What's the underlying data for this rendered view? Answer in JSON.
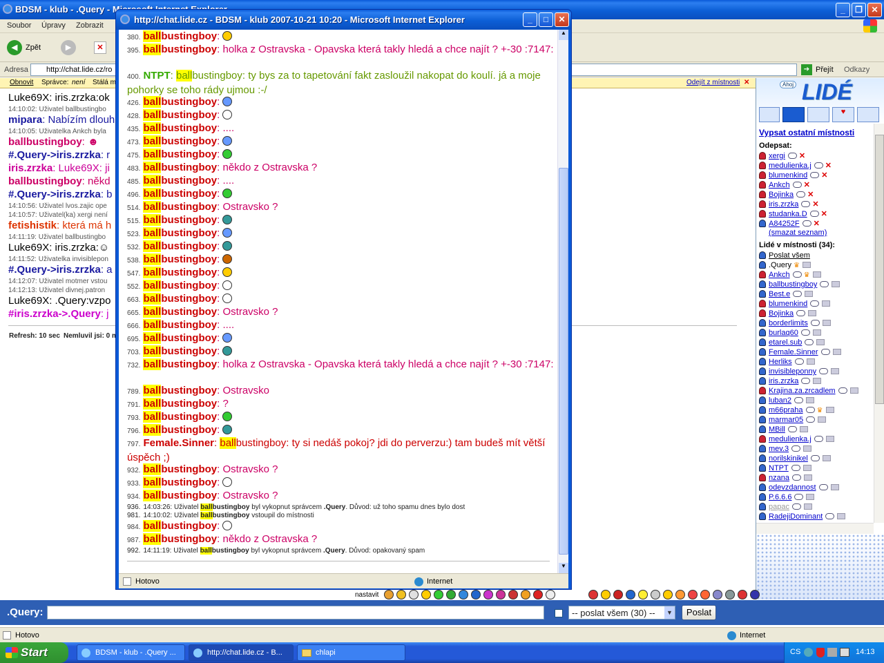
{
  "back_window": {
    "title": "BDSM - klub - .Query - Microsoft Internet Explorer",
    "menu": [
      "Soubor",
      "Úpravy",
      "Zobrazit"
    ],
    "back_label": "Zpět",
    "address_label": "Adresa",
    "address_value": "http://chat.lide.cz/ro",
    "go_label": "Přejít",
    "links_label": "Odkazy",
    "topbar": {
      "refresh": "Obnovit",
      "admin": "Správce:",
      "admin_value": "není",
      "stale": "Stálá m",
      "leave": "Odejít z místnosti"
    },
    "chat_lines": [
      {
        "nick": "Luke69X",
        "text": ": iris.zrzka:ok",
        "color": "#000000",
        "kind": "line"
      },
      {
        "text": "14:10:02: Uživatel ballbustingbo",
        "kind": "sys"
      },
      {
        "nick": "mipara",
        "text": ": Nabízím dlouh",
        "color": "#1a1aa0",
        "kind": "line"
      },
      {
        "text": "14:10:05: Uživatelka Ankch byla",
        "kind": "sys"
      },
      {
        "nick": "ballbustingboy",
        "text": ": ☻",
        "color": "#cc0066",
        "kind": "line"
      },
      {
        "nick": "#.Query->iris.zrzka",
        "text": ": r",
        "color": "#1a1aa0",
        "kind": "line"
      },
      {
        "nick": "iris.zrzka",
        "text": ": Luke69X: ji",
        "color": "#cc0099",
        "kind": "line"
      },
      {
        "nick": "ballbustingboy",
        "text": ": někd",
        "color": "#cc0066",
        "kind": "line"
      },
      {
        "nick": "#.Query->iris.zrzka",
        "text": ": b",
        "color": "#1a1aa0",
        "kind": "line"
      },
      {
        "text": "14:10:56: Uživatel lvos.zajic ope",
        "kind": "sys"
      },
      {
        "text": "14:10:57: Uživatel(ka) xergi není",
        "kind": "sys"
      },
      {
        "nick": "fetishistik",
        "text": ": která má h",
        "color": "#dd3300",
        "kind": "line"
      },
      {
        "text": "14:11:19: Uživatel ballbustingbo",
        "kind": "sys"
      },
      {
        "nick": "Luke69X",
        "text": ": iris.zrzka:☺",
        "color": "#000000",
        "kind": "line"
      },
      {
        "text": "14:11:52: Uživatelka invisiblepon",
        "kind": "sys"
      },
      {
        "nick": "#.Query->iris.zrzka",
        "text": ": a",
        "color": "#1a1aa0",
        "kind": "line"
      },
      {
        "text": "14:12:07: Uživatel motmer vstou",
        "kind": "sys"
      },
      {
        "text": "14:12:13: Uživatel divnej.patron",
        "kind": "sys"
      },
      {
        "nick": "Luke69X",
        "text": ": .Query:vzpo",
        "color": "#000000",
        "kind": "line"
      },
      {
        "nick": "#iris.zrzka->.Query",
        "text": ": j",
        "color": "#cc00cc",
        "kind": "line"
      }
    ],
    "refresh_info": "Refresh: 10 sec",
    "idle_info": "Nemluvil jsi: 0 m",
    "emoticon_label": "nastavit",
    "input_label": ".Query:",
    "send_select": "-- poslat všem (30) --",
    "send_button": "Poslat",
    "status_left": "Hotovo",
    "status_zone": "Internet"
  },
  "sidebar": {
    "logo": "LIDÉ",
    "logo_small": "Ahoj",
    "list_rooms": "Vypsat ostatní místnosti",
    "unsubscribe_header": "Odepsat:",
    "unsubscribe": [
      "xergi",
      "medulienka.j",
      "blumenkind",
      "Ankch",
      "Bojinka",
      "iris.zrzka",
      "studanka.D",
      "A84252F"
    ],
    "clear_list": "(smazat seznam)",
    "people_header": "Lidé v místnosti (34):",
    "send_all": "Poslat všem",
    "people": [
      ".Query",
      "Ankch",
      "ballbustingboy",
      "Best.e",
      "blumenkind",
      "Bojinka",
      "borderlimits",
      "burlaq60",
      "etarel.sub",
      "Female.Sinner",
      "Herliks",
      "invisibleponny",
      "iris.zrzka",
      "Krajina.za.zrcadlem",
      "luban2",
      "m66praha",
      "marmar05",
      "MBill",
      "medulienka.j",
      "mev.3",
      "norilskinikel",
      "NTPT",
      "nzana",
      "odevzdannost",
      "P.6.6.6",
      "papac",
      "RadejiDominant"
    ]
  },
  "popup": {
    "title": "http://chat.lide.cz - BDSM - klub 2007-10-21 10:20 - Microsoft Internet Explorer",
    "hl": "ball",
    "status_left": "Hotovo",
    "status_zone": "Internet",
    "log": [
      {
        "num": "380.",
        "nick": "ballbustingboy",
        "text": "",
        "emo": "#ffcc00"
      },
      {
        "num": "395.",
        "nick": "ballbustingboy",
        "text": "holka z Ostravska - Opavska která takly hledá a chce najít ? +-30 :7147:",
        "lines": 2
      },
      {
        "num": "400.",
        "nick": "NTPT",
        "target": "bustingboy",
        "text": ": ty bys za to tapetování fakt zasloužil nakopat do koulí. já a moje pohorky se toho rády ujmou :-/",
        "style": "g",
        "lines": 2
      },
      {
        "num": "426.",
        "nick": "ballbustingboy",
        "text": "",
        "emo": "#6699ff"
      },
      {
        "num": "428.",
        "nick": "ballbustingboy",
        "text": "",
        "emo": "#ffffff"
      },
      {
        "num": "435.",
        "nick": "ballbustingboy",
        "text": "...."
      },
      {
        "num": "473.",
        "nick": "ballbustingboy",
        "text": "",
        "emo": "#6699ff"
      },
      {
        "num": "475.",
        "nick": "ballbustingboy",
        "text": "",
        "emo": "#33cc33"
      },
      {
        "num": "483.",
        "nick": "ballbustingboy",
        "text": "někdo z Ostravska ?"
      },
      {
        "num": "485.",
        "nick": "ballbustingboy",
        "text": "...."
      },
      {
        "num": "496.",
        "nick": "ballbustingboy",
        "text": "",
        "emo": "#33cc33"
      },
      {
        "num": "514.",
        "nick": "ballbustingboy",
        "text": "Ostravsko ?"
      },
      {
        "num": "515.",
        "nick": "ballbustingboy",
        "text": "",
        "emo": "#339999"
      },
      {
        "num": "523.",
        "nick": "ballbustingboy",
        "text": "",
        "emo": "#6699ff"
      },
      {
        "num": "532.",
        "nick": "ballbustingboy",
        "text": "",
        "emo": "#339999"
      },
      {
        "num": "538.",
        "nick": "ballbustingboy",
        "text": "",
        "emo": "#cc6600"
      },
      {
        "num": "547.",
        "nick": "ballbustingboy",
        "text": "",
        "emo": "#ffcc00"
      },
      {
        "num": "552.",
        "nick": "ballbustingboy",
        "text": "",
        "emo": "#ffffff"
      },
      {
        "num": "663.",
        "nick": "ballbustingboy",
        "text": "",
        "emo": "#ffffff"
      },
      {
        "num": "665.",
        "nick": "ballbustingboy",
        "text": "Ostravsko ?"
      },
      {
        "num": "666.",
        "nick": "ballbustingboy",
        "text": "...."
      },
      {
        "num": "695.",
        "nick": "ballbustingboy",
        "text": "",
        "emo": "#6699ff"
      },
      {
        "num": "703.",
        "nick": "ballbustingboy",
        "text": "",
        "emo": "#339999"
      },
      {
        "num": "732.",
        "nick": "ballbustingboy",
        "text": "holka z Ostravska - Opavska která takly hledá a chce najít ? +-30 :7147:",
        "lines": 2
      },
      {
        "num": "789.",
        "nick": "ballbustingboy",
        "text": "Ostravsko"
      },
      {
        "num": "791.",
        "nick": "ballbustingboy",
        "text": "?"
      },
      {
        "num": "793.",
        "nick": "ballbustingboy",
        "text": "",
        "emo": "#33cc33"
      },
      {
        "num": "796.",
        "nick": "ballbustingboy",
        "text": "",
        "emo": "#339999"
      },
      {
        "num": "797.",
        "nick": "Female.Sinner",
        "target": "bustingboy",
        "text": ": ty si nedáš pokoj? jdi do perverzu:) tam budeš mít větší úspěch ;)",
        "style": "r",
        "lines": 2
      },
      {
        "num": "932.",
        "nick": "ballbustingboy",
        "text": "Ostravsko ?"
      },
      {
        "num": "933.",
        "nick": "ballbustingboy",
        "text": "",
        "emo": "#ffffff"
      },
      {
        "num": "934.",
        "nick": "ballbustingboy",
        "text": "Ostravsko ?"
      },
      {
        "num": "936.",
        "sys": true,
        "pre": "14:03:26: Uživatel ",
        "bold": "bustingboy",
        "post": " byl vykopnut správcem ",
        "admin": ".Query",
        "reason": ". Důvod: už toho spamu dnes bylo dost"
      },
      {
        "num": "981.",
        "sys": true,
        "pre": "14:10:02: Uživatel ",
        "bold": "bustingboy",
        "post": " vstoupil do místnosti"
      },
      {
        "num": "984.",
        "nick": "ballbustingboy",
        "text": "",
        "emo": "#ffffff"
      },
      {
        "num": "987.",
        "nick": "ballbustingboy",
        "text": "někdo z Ostravska ?"
      },
      {
        "num": "992.",
        "sys": true,
        "pre": "14:11:19: Uživatel ",
        "bold": "bustingboy",
        "post": " byl vykopnut správcem ",
        "admin": ".Query",
        "reason": ". Důvod: opakovaný spam"
      }
    ]
  },
  "taskbar": {
    "start": "Start",
    "items": [
      "BDSM - klub - .Query ...",
      "http://chat.lide.cz - B...",
      "chlapi"
    ],
    "lang": "CS",
    "clock": "14:13"
  }
}
